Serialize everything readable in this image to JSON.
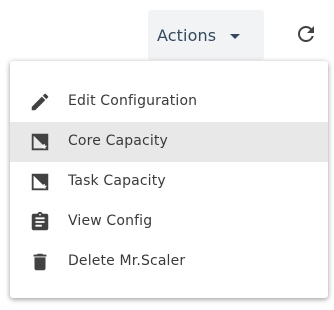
{
  "header": {
    "actions_label": "Actions",
    "refresh_icon": "refresh-icon"
  },
  "menu": {
    "items": [
      {
        "label": "Edit Configuration",
        "icon": "pencil-icon",
        "hovered": false
      },
      {
        "label": "Core Capacity",
        "icon": "capacity-icon",
        "hovered": true
      },
      {
        "label": "Task Capacity",
        "icon": "capacity-icon",
        "hovered": false
      },
      {
        "label": "View Config",
        "icon": "clipboard-icon",
        "hovered": false
      },
      {
        "label": "Delete Mr.Scaler",
        "icon": "trash-icon",
        "hovered": false
      }
    ]
  },
  "colors": {
    "button_bg": "#f2f3f5",
    "button_text": "#34495e",
    "menu_text": "#3a3a3a",
    "icon_color": "#424242",
    "hover_bg": "#e8e8e8"
  }
}
